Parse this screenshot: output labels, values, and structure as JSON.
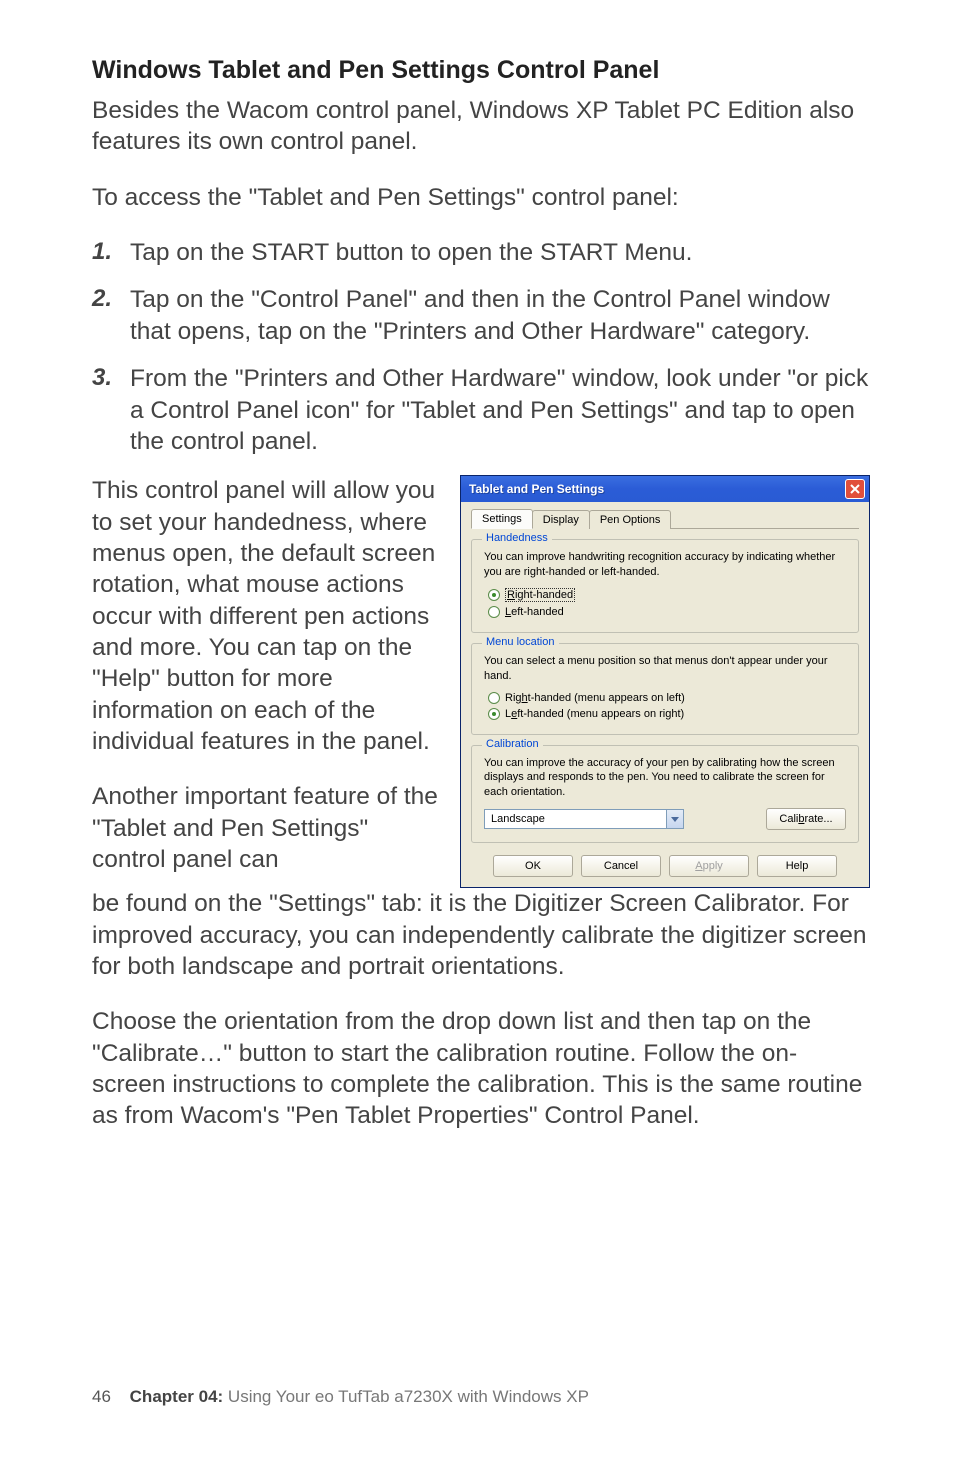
{
  "heading": "Windows Tablet and Pen Settings Control Panel",
  "para1": "Besides the Wacom control panel, Windows XP Tablet PC Edition also features its own control panel.",
  "para2": "To access the \"Tablet and Pen Settings\" control panel:",
  "steps": [
    {
      "num": "1.",
      "text": "Tap on the START button to open the START Menu."
    },
    {
      "num": "2.",
      "text": "Tap on the \"Control Panel\" and then in the Control Panel window that opens, tap on the \"Printers and Other Hardware\" category."
    },
    {
      "num": "3.",
      "text": "From the \"Printers and Other Hardware\" window, look under \"or pick a Control Panel icon\" for \"Tablet and Pen Settings\" and tap to open the control panel."
    }
  ],
  "left1": "This control panel will allow you to set your handedness, where menus open, the default screen rotation, what mouse actions occur with different pen actions and more. You can tap on the \"Help\" button for more information on each of the individual features in the panel.",
  "left2": "Another important feature of the \"Tablet and Pen Settings\" control panel can",
  "after1": "be found on the \"Settings\" tab: it is the Digitizer Screen Calibrator. For improved accuracy, you can independently calibrate the digitizer screen for both landscape and portrait orientations.",
  "after2": "Choose the orientation from the drop down list and then tap on the \"Calibrate…\" button to start the calibration routine. Follow the on-screen instructions to complete the calibration. This is the same routine as from Wacom's \"Pen Tablet Properties\" Control Panel.",
  "dialog": {
    "title": "Tablet and Pen Settings",
    "tabs": {
      "settings": "Settings",
      "display": "Display",
      "pen": "Pen Options"
    },
    "handedness": {
      "legend": "Handedness",
      "desc": "You can improve handwriting recognition accuracy by indicating whether you are right-handed or left-handed.",
      "right_pre": "R",
      "right_rest": "ight-handed",
      "left_pre": "L",
      "left_rest": "eft-handed"
    },
    "menu": {
      "legend": "Menu location",
      "desc": "You can select a menu position so that menus don't appear under your hand.",
      "right_pre_a": "Rig",
      "right_u": "h",
      "right_post": "t-handed (menu appears on left)",
      "left_pre_a": "L",
      "left_u": "e",
      "left_post": "ft-handed (menu appears on right)"
    },
    "calib": {
      "legend": "Calibration",
      "desc": "You can improve the accuracy of your pen by calibrating how the screen displays and responds to the pen. You need to calibrate the screen for each orientation.",
      "select": "Landscape",
      "btn_pre": "Cali",
      "btn_u": "b",
      "btn_post": "rate..."
    },
    "buttons": {
      "ok": "OK",
      "cancel": "Cancel",
      "apply_u": "A",
      "apply_rest": "pply",
      "help": "Help"
    }
  },
  "footer": {
    "page": "46",
    "chapter": "Chapter 04:",
    "title": " Using Your eo TufTab a7230X with Windows XP"
  }
}
